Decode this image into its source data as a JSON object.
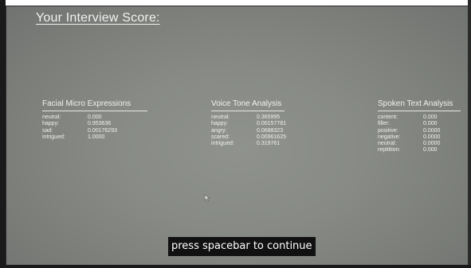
{
  "page": {
    "title": "Your Interview Score:"
  },
  "facial": {
    "title": "Facial Micro Expressions",
    "rows": [
      {
        "label": "neutral:",
        "value": "0.000"
      },
      {
        "label": "happy:",
        "value": "0.953636"
      },
      {
        "label": "sad:",
        "value": "0.00176293"
      },
      {
        "label": "intrigued:",
        "value": "1.0000"
      }
    ]
  },
  "voice": {
    "title": "Voice Tone Analysis",
    "rows": [
      {
        "label": "neutral:",
        "value": "0.365995"
      },
      {
        "label": "happy:",
        "value": "0.00157781"
      },
      {
        "label": "angry:",
        "value": "0.0688323"
      },
      {
        "label": "scared:",
        "value": "0.00961625"
      },
      {
        "label": "intrigued:",
        "value": "0.319761"
      }
    ]
  },
  "text": {
    "title": "Spoken Text Analysis",
    "rows": [
      {
        "label": "content:",
        "value": "0.000"
      },
      {
        "label": "filler:",
        "value": "0.000"
      },
      {
        "label": "positive:",
        "value": "0.0000"
      },
      {
        "label": "negative:",
        "value": "0.0000"
      },
      {
        "label": "neutral:",
        "value": "0.0000"
      },
      {
        "label": "repitition:",
        "value": "0.000"
      }
    ]
  },
  "footer": {
    "continue_label": "press spacebar to continue"
  },
  "icons": {
    "cursor": "mouse-pointer-icon"
  }
}
